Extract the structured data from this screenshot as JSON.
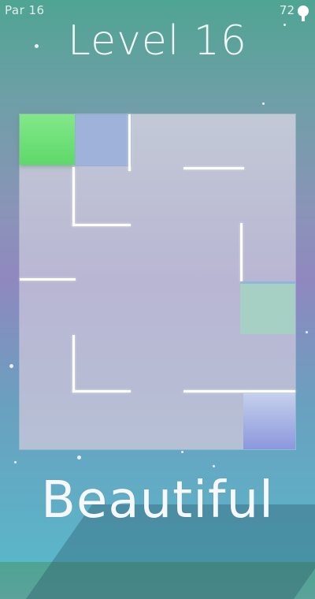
{
  "header": {
    "par_label": "Par 16",
    "coins": "72",
    "hint_icon": "lightbulb-icon"
  },
  "level": {
    "title": "Level 16"
  },
  "board": {
    "tiles": [
      {
        "name": "player-tile",
        "color": "#6fdc7a"
      },
      {
        "name": "blue-tile",
        "color": "#9fb3da"
      },
      {
        "name": "teal-tile",
        "color": "#a7d0c4"
      },
      {
        "name": "goal-tile",
        "color": "#8c97dd"
      }
    ]
  },
  "footer": {
    "tagline": "Beautiful"
  },
  "colors": {
    "background_top": "#4fa493",
    "background_mid": "#8f88bf",
    "background_bottom": "#5ab6c9",
    "wall": "#ffffff"
  }
}
